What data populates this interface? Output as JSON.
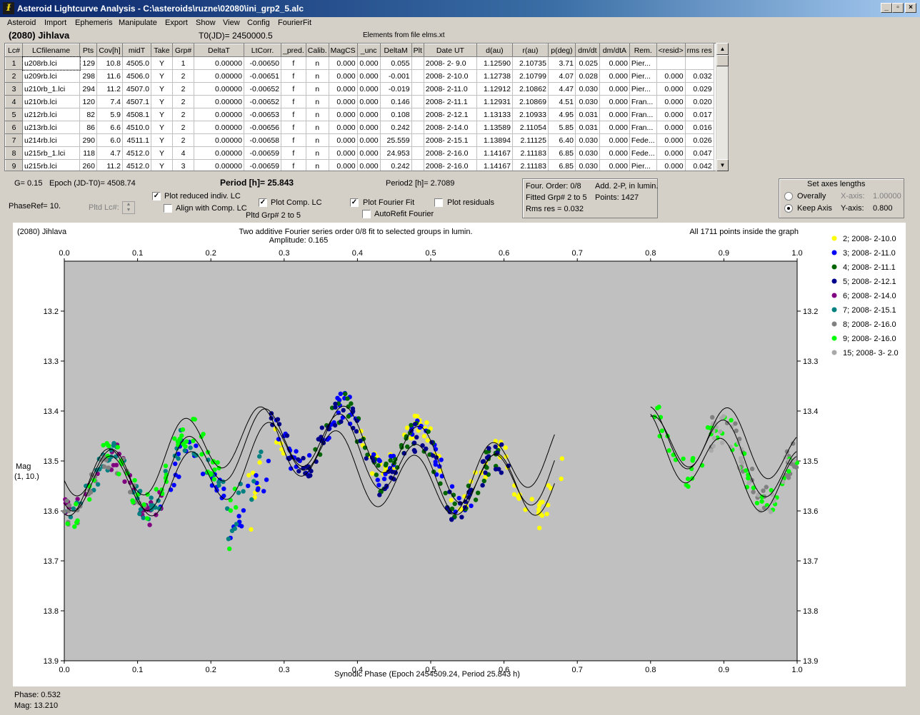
{
  "window": {
    "title": "Asteroid Lightcurve Analysis - C:\\asteroids\\ruzne\\02080\\ini_grp2_5.alc",
    "icon_name": "alc-app-icon",
    "minimize": "_",
    "maximize": "▫",
    "close": "×"
  },
  "menu": [
    "Asteroid",
    "Import",
    "Ephemeris",
    "Manipulate",
    "Export",
    "Show",
    "View",
    "Config",
    "FourierFit"
  ],
  "header": {
    "asteroid": "(2080) Jihlava",
    "t0": "T0(JD)= 2450000.5",
    "elements": "Elements from file elms.xt"
  },
  "table": {
    "columns": [
      "Lc#",
      "LCfilename",
      "Pts",
      "Cov[h]",
      "midT",
      "Take",
      "Grp#",
      "DeltaT",
      "LtCorr.",
      "_pred.",
      "Calib.",
      "MagCS",
      "_unc",
      "DeltaM",
      "Plt",
      "Date UT",
      "d(au)",
      "r(au)",
      "p(deg)",
      "dm/dt",
      "dm/dtA",
      "Rem.",
      "<resid>",
      "rms res"
    ],
    "rows": [
      [
        "1",
        "u208rb.lci",
        "129",
        "10.8",
        "4505.0",
        "Y",
        "1",
        "0.00000",
        "-0.00650",
        "f",
        "n",
        "0.000",
        "0.000",
        "0.055",
        "",
        "2008- 2- 9.0",
        "1.12590",
        "2.10735",
        "3.71",
        "0.025",
        "0.000",
        "Pier...",
        "",
        ""
      ],
      [
        "2",
        "u209rb.lci",
        "298",
        "11.6",
        "4506.0",
        "Y",
        "2",
        "0.00000",
        "-0.00651",
        "f",
        "n",
        "0.000",
        "0.000",
        "-0.001",
        "",
        "2008- 2-10.0",
        "1.12738",
        "2.10799",
        "4.07",
        "0.028",
        "0.000",
        "Pier...",
        "0.000",
        "0.032"
      ],
      [
        "3",
        "u210rb_1.lci",
        "294",
        "11.2",
        "4507.0",
        "Y",
        "2",
        "0.00000",
        "-0.00652",
        "f",
        "n",
        "0.000",
        "0.000",
        "-0.019",
        "",
        "2008- 2-11.0",
        "1.12912",
        "2.10862",
        "4.47",
        "0.030",
        "0.000",
        "Pier...",
        "0.000",
        "0.029"
      ],
      [
        "4",
        "u210rb.lci",
        "120",
        "7.4",
        "4507.1",
        "Y",
        "2",
        "0.00000",
        "-0.00652",
        "f",
        "n",
        "0.000",
        "0.000",
        "0.146",
        "",
        "2008- 2-11.1",
        "1.12931",
        "2.10869",
        "4.51",
        "0.030",
        "0.000",
        "Fran...",
        "0.000",
        "0.020"
      ],
      [
        "5",
        "u212rb.lci",
        "82",
        "5.9",
        "4508.1",
        "Y",
        "2",
        "0.00000",
        "-0.00653",
        "f",
        "n",
        "0.000",
        "0.000",
        "0.108",
        "",
        "2008- 2-12.1",
        "1.13133",
        "2.10933",
        "4.95",
        "0.031",
        "0.000",
        "Fran...",
        "0.000",
        "0.017"
      ],
      [
        "6",
        "u213rb.lci",
        "86",
        "6.6",
        "4510.0",
        "Y",
        "2",
        "0.00000",
        "-0.00656",
        "f",
        "n",
        "0.000",
        "0.000",
        "0.242",
        "",
        "2008- 2-14.0",
        "1.13589",
        "2.11054",
        "5.85",
        "0.031",
        "0.000",
        "Fran...",
        "0.000",
        "0.016"
      ],
      [
        "7",
        "u214rb.lci",
        "290",
        "6.0",
        "4511.1",
        "Y",
        "2",
        "0.00000",
        "-0.00658",
        "f",
        "n",
        "0.000",
        "0.000",
        "25.559",
        "",
        "2008- 2-15.1",
        "1.13894",
        "2.11125",
        "6.40",
        "0.030",
        "0.000",
        "Fede...",
        "0.000",
        "0.026"
      ],
      [
        "8",
        "u215rb_1.lci",
        "118",
        "4.7",
        "4512.0",
        "Y",
        "4",
        "0.00000",
        "-0.00659",
        "f",
        "n",
        "0.000",
        "0.000",
        "24.953",
        "",
        "2008- 2-16.0",
        "1.14167",
        "2.11183",
        "6.85",
        "0.030",
        "0.000",
        "Fede...",
        "0.000",
        "0.047"
      ],
      [
        "9",
        "u215rb.lci",
        "260",
        "11.2",
        "4512.0",
        "Y",
        "3",
        "0.00000",
        "-0.00659",
        "f",
        "n",
        "0.000",
        "0.000",
        "0.242",
        "",
        "2008- 2-16.0",
        "1.14167",
        "2.11183",
        "6.85",
        "0.030",
        "0.000",
        "Pier...",
        "0.000",
        "0.042"
      ]
    ]
  },
  "controls": {
    "g": "G= 0.15",
    "epoch": "Epoch (JD-T0)= 4508.74",
    "period": "Period [h]= 25.843",
    "period2": "Period2 [h]= 2.7089",
    "phaseref": "PhaseRef= 10.",
    "pltd_lc": "Pltd Lc#:",
    "plot_reduced": "Plot reduced indiv. LC",
    "align_comp": "Align with Comp. LC",
    "plot_comp": "Plot Comp. LC",
    "pltd_grp": "Pltd Grp#  2   to   5",
    "plot_fourier": "Plot Fourier Fit",
    "autorefit": "AutoRefit Fourier",
    "plot_residuals": "Plot residuals",
    "plot_reduced_checked": true,
    "align_comp_checked": false,
    "plot_comp_checked": true,
    "plot_fourier_checked": true,
    "autorefit_checked": false,
    "plot_residuals_checked": false
  },
  "fourier_info": {
    "order": "Four. Order:  0/8",
    "add": "Add. 2-P, in lumin.",
    "fitted": "Fitted Grp# 2 to 5",
    "points": "Points: 1427",
    "rms": "Rms res      = 0.032"
  },
  "axes_box": {
    "title": "Set axes lengths",
    "overally": "Overally",
    "keep": "Keep Axis",
    "xaxis_label": "X-axis:",
    "xaxis_value": "1.00000",
    "yaxis_label": "Y-axis:",
    "yaxis_value": "0.800",
    "mode": "keep"
  },
  "chart_data": {
    "type": "scatter",
    "title_left": "(2080) Jihlava",
    "title": "Two additive Fourier series order 0/8 fit to selected groups in lumin.",
    "subtitle": "Amplitude: 0.165",
    "note": "All 1711 points inside the graph",
    "xlabel": "Synodic Phase (Epoch 2454509.24, Period 25.843 h)",
    "ylabel": "Mag",
    "ylabel2": "(1, 10.)",
    "xlim": [
      0.0,
      1.0
    ],
    "ylim": [
      13.9,
      13.1
    ],
    "x_ticks": [
      "0.0",
      "0.1",
      "0.2",
      "0.3",
      "0.4",
      "0.5",
      "0.6",
      "0.7",
      "0.8",
      "0.9",
      "1.0"
    ],
    "y_ticks": [
      "13.2",
      "13.3",
      "13.4",
      "13.5",
      "13.6",
      "13.7",
      "13.8",
      "13.9"
    ],
    "grid": false,
    "legend_position": "right",
    "series": [
      {
        "name": "2; 2008- 2-10.0",
        "color": "#ffff00",
        "ranges": [
          [
            0.25,
            0.3
          ],
          [
            0.4,
            0.68
          ]
        ]
      },
      {
        "name": "3; 2008- 2-11.0",
        "color": "#0000ff",
        "ranges": [
          [
            0.13,
            0.56
          ]
        ]
      },
      {
        "name": "4; 2008- 2-11.1",
        "color": "#006400",
        "ranges": [
          [
            0.33,
            0.6
          ]
        ]
      },
      {
        "name": "5; 2008- 2-12.1",
        "color": "#00008b",
        "ranges": [
          [
            0.28,
            0.62
          ]
        ]
      },
      {
        "name": "6; 2008- 2-14.0",
        "color": "#800080",
        "ranges": [
          [
            0.0,
            0.14
          ]
        ]
      },
      {
        "name": "7; 2008- 2-15.1",
        "color": "#008080",
        "ranges": [
          [
            0.0,
            0.27
          ]
        ]
      },
      {
        "name": "8; 2008- 2-16.0",
        "color": "#808080",
        "ranges": [
          [
            0.0,
            0.11
          ],
          [
            0.88,
            1.0
          ]
        ]
      },
      {
        "name": "9; 2008- 2-16.0",
        "color": "#00ff00",
        "ranges": [
          [
            0.0,
            0.24
          ],
          [
            0.8,
            1.0
          ]
        ]
      },
      {
        "name": "15; 2008- 3- 2.0",
        "color": "#a9a9a9",
        "ranges": [
          [
            0.88,
            1.0
          ]
        ]
      }
    ],
    "fit_color": "#000000",
    "fit_ranges": [
      [
        0.0,
        0.67
      ],
      [
        0.8,
        1.0
      ]
    ]
  },
  "status": {
    "phase": "Phase:  0.532",
    "mag": "Mag:    13.210"
  }
}
